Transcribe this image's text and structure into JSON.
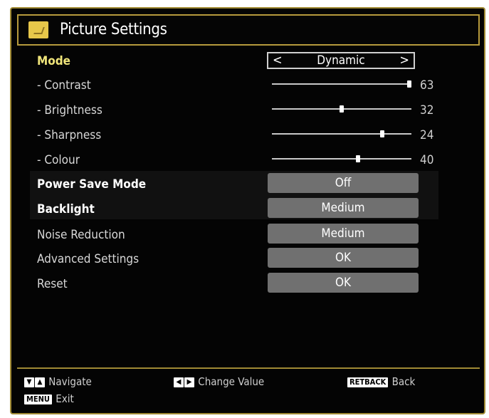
{
  "title": "Picture Settings",
  "mode": {
    "label": "Mode",
    "value": "Dynamic",
    "left_arrow": "<",
    "right_arrow": ">"
  },
  "sliders": [
    {
      "label": "- Contrast",
      "value": "63",
      "level": 1.0
    },
    {
      "label": "- Brightness",
      "value": "32",
      "level": 0.5
    },
    {
      "label": "- Sharpness",
      "value": "24",
      "level": 0.8
    },
    {
      "label": "- Colour",
      "value": "40",
      "level": 0.62
    }
  ],
  "options": [
    {
      "label": "Power Save Mode",
      "value": "Off"
    },
    {
      "label": "Backlight",
      "value": "Medium"
    },
    {
      "label": "Noise Reduction",
      "value": "Medium"
    },
    {
      "label": "Advanced Settings",
      "value": "OK"
    },
    {
      "label": "Reset",
      "value": "OK"
    }
  ],
  "footer": {
    "navigate": "Navigate",
    "change_value": "Change Value",
    "back": "Back",
    "exit": "Exit",
    "retback_key": "RETBACK",
    "menu_key": "MENU",
    "nav_down_key": "▼",
    "nav_up_key": "▲",
    "left_key": "◀",
    "right_key": "▶"
  },
  "colors": {
    "frame": "#a08a34",
    "mode_label": "#f0e57a",
    "option_box": "#707070"
  }
}
